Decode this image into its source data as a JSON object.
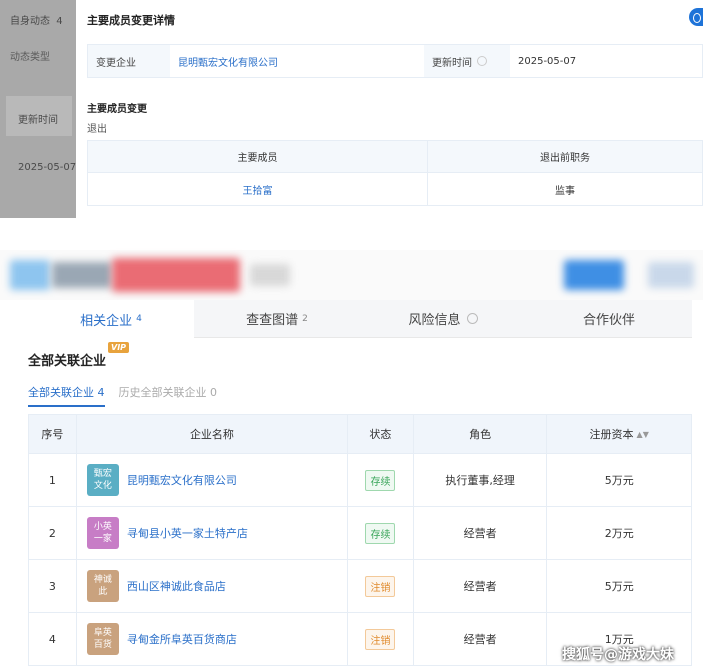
{
  "sidebar": {
    "items": [
      {
        "label": "自身动态",
        "count": "4"
      },
      {
        "label": "动态类型"
      },
      {
        "label": "更新时间"
      },
      {
        "label": "2025-05-07"
      }
    ]
  },
  "detail": {
    "title": "主要成员变更详情",
    "company_label": "变更企业",
    "company_value": "昆明甄宏文化有限公司",
    "update_label": "更新时间",
    "update_value": "2025-05-07",
    "change_title": "主要成员变更",
    "change_type": "退出",
    "member_headers": [
      "主要成员",
      "退出前职务"
    ],
    "members": [
      {
        "name": "王拾富",
        "position": "监事"
      }
    ]
  },
  "tabs": [
    {
      "label": "相关企业",
      "count": "4"
    },
    {
      "label": "查查图谱",
      "count": "2"
    },
    {
      "label": "风险信息",
      "count": ""
    },
    {
      "label": "合作伙伴",
      "count": ""
    }
  ],
  "section": {
    "title": "全部关联企业",
    "badge": "VIP",
    "subtabs": [
      {
        "label": "全部关联企业",
        "count": "4"
      },
      {
        "label": "历史全部关联企业",
        "count": "0"
      }
    ]
  },
  "table": {
    "headers": [
      "序号",
      "企业名称",
      "状态",
      "角色",
      "注册资本"
    ],
    "rows": [
      {
        "index": "1",
        "logo": "甄宏\n文化",
        "logo_color": "#5aaec4",
        "name": "昆明甄宏文化有限公司",
        "status": "存续",
        "status_kind": "ok",
        "role": "执行董事,经理",
        "capital": "5万元"
      },
      {
        "index": "2",
        "logo": "小英\n一家",
        "logo_color": "#c77dc6",
        "name": "寻甸县小英一家土特产店",
        "status": "存续",
        "status_kind": "ok",
        "role": "经营者",
        "capital": "2万元"
      },
      {
        "index": "3",
        "logo": "神诚\n此",
        "logo_color": "#c9a27e",
        "name": "西山区神诚此食品店",
        "status": "注销",
        "status_kind": "cancel",
        "role": "经营者",
        "capital": "5万元"
      },
      {
        "index": "4",
        "logo": "阜英\n百货",
        "logo_color": "#c9a27e",
        "name": "寻甸金所阜英百货商店",
        "status": "注销",
        "status_kind": "cancel",
        "role": "经营者",
        "capital": "1万元"
      }
    ]
  },
  "watermark": "搜狐号@游戏大妹",
  "colors": {
    "accent": "#2a6fc9",
    "sidebar_bg": "#a9a9a9"
  }
}
